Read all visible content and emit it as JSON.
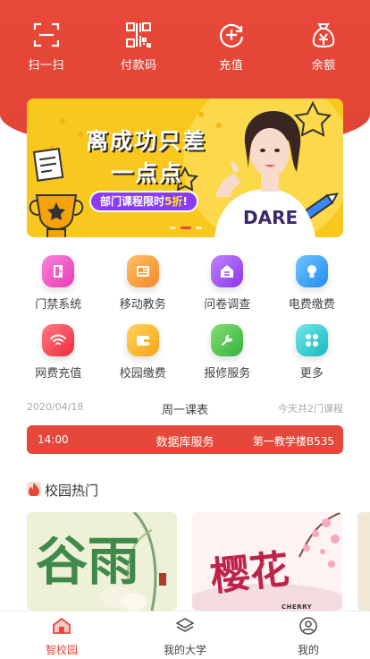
{
  "quick_actions": [
    {
      "label": "扫一扫",
      "icon": "scan-icon"
    },
    {
      "label": "付款码",
      "icon": "barcode-icon"
    },
    {
      "label": "充值",
      "icon": "recharge-icon"
    },
    {
      "label": "余额",
      "icon": "money-bag-icon"
    }
  ],
  "banner": {
    "title_line1": "离成功只差",
    "title_line2": "一点点",
    "promo_prefix": "部门课程限时",
    "promo_highlight": "5折",
    "promo_suffix": "!",
    "slide_count": 3,
    "active_slide": 2
  },
  "services": [
    {
      "label": "门禁系统",
      "icon": "door-icon",
      "color": "#f04fc0"
    },
    {
      "label": "移动教务",
      "icon": "id-card-icon",
      "color": "#fb9a2e"
    },
    {
      "label": "问卷调查",
      "icon": "house-doc-icon",
      "color": "#9a4cf2"
    },
    {
      "label": "电费缴费",
      "icon": "bulb-icon",
      "color": "#2c9cf5"
    },
    {
      "label": "网费充值",
      "icon": "wifi-icon",
      "color": "#f33d4a"
    },
    {
      "label": "校园缴费",
      "icon": "wallet-icon",
      "color": "#fbb320"
    },
    {
      "label": "报修服务",
      "icon": "wrench-icon",
      "color": "#49c14f"
    },
    {
      "label": "更多",
      "icon": "more-grid-icon",
      "color": "#2fcad0"
    }
  ],
  "schedule": {
    "date": "2020/04/18",
    "day": "周一课表",
    "count": "今天共2门课程",
    "course": {
      "time": "14:00",
      "name": "数据库服务",
      "room": "第一教学楼B535"
    }
  },
  "hot": {
    "title": "校园热门",
    "cards": [
      {
        "text": "谷雨",
        "sub": ""
      },
      {
        "text": "樱花",
        "sub": "CHERRY"
      },
      {
        "text": "",
        "sub": ""
      }
    ]
  },
  "tabbar": [
    {
      "label": "智校园",
      "icon": "home-icon",
      "active": true
    },
    {
      "label": "我的大学",
      "icon": "layers-icon",
      "active": false
    },
    {
      "label": "我的",
      "icon": "user-icon",
      "active": false
    }
  ],
  "colors": {
    "primary": "#e5483a",
    "banner_bg": "#f9c81f",
    "promo": "#8a3cf0"
  }
}
